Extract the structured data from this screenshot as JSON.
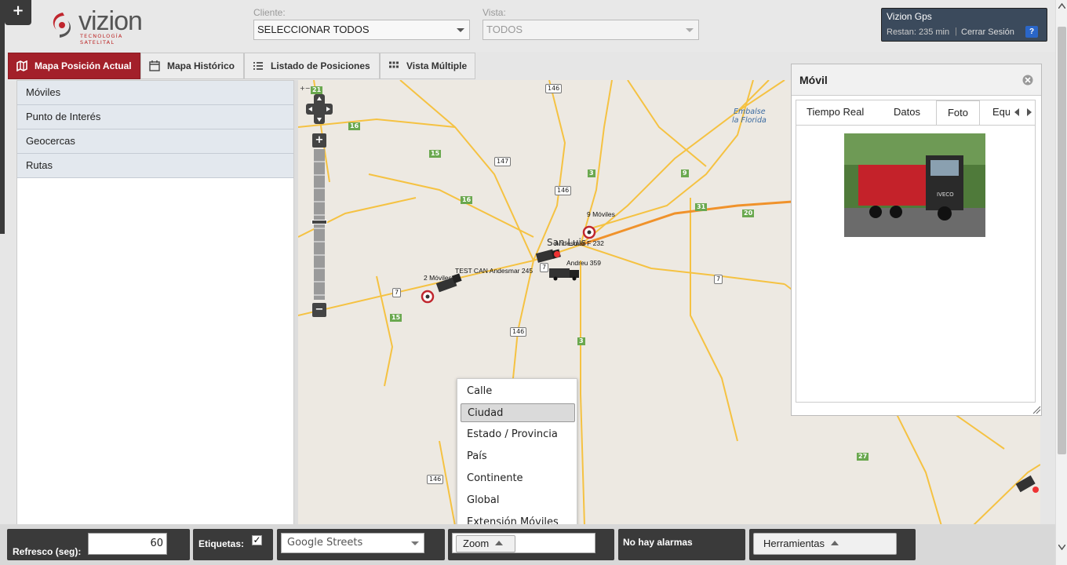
{
  "header": {
    "plus_label": "+",
    "logo_text": "vizion",
    "logo_sub": "TECNOLOGÍA SATELITAL",
    "cliente_label": "Cliente:",
    "cliente_value": "SELECCIONAR TODOS",
    "vista_label": "Vista:",
    "vista_value": "TODOS",
    "user_title": "Vizion Gps",
    "restan": "Restan: 235 min",
    "cerrar": "Cerrar Sesión",
    "help": "?"
  },
  "tabs": [
    {
      "label": "Mapa Posición Actual",
      "icon": "map-icon",
      "active": true
    },
    {
      "label": "Mapa Histórico",
      "icon": "calendar-icon",
      "active": false
    },
    {
      "label": "Listado de Posiciones",
      "icon": "list-icon",
      "active": false
    },
    {
      "label": "Vista Múltiple",
      "icon": "grid-icon",
      "active": false
    }
  ],
  "sidebar": {
    "items": [
      {
        "label": "Móviles"
      },
      {
        "label": "Punto de Interés"
      },
      {
        "label": "Geocercas"
      },
      {
        "label": "Rutas"
      }
    ]
  },
  "map": {
    "road_shields": [
      "146",
      "147",
      "146",
      "146",
      "146",
      "7",
      "7",
      "7"
    ],
    "green_badges": [
      "21",
      "16",
      "15",
      "16",
      "15",
      "3",
      "9",
      "31",
      "20",
      "3",
      "27"
    ],
    "lake_label_1": "Embalse",
    "lake_label_2": "la Florida",
    "city_label": "San Luis",
    "markers": [
      {
        "label": "9 Móviles"
      },
      {
        "label": "Andesmar F 232"
      },
      {
        "label": "Andreu 359"
      },
      {
        "label": "2 Móviles"
      },
      {
        "label": "TEST CAN Andesmar 245"
      }
    ],
    "zoom_plus": "+",
    "zoom_minus": "−",
    "scale_label": "+−"
  },
  "zoom_menu": {
    "options": [
      "Calle",
      "Ciudad",
      "Estado / Provincia",
      "País",
      "Continente",
      "Global",
      "Extensión Móviles"
    ],
    "selected": "Ciudad"
  },
  "movil_panel": {
    "title": "Móvil",
    "tabs": [
      "Tiempo Real",
      "Datos",
      "Foto",
      "Equ"
    ],
    "active_tab": "Foto",
    "truck_brand": "IVECO"
  },
  "bottom": {
    "refresco_label": "Refresco (seg):",
    "refresco_value": "60",
    "etiquetas_label": "Etiquetas:",
    "etiquetas_checked": true,
    "map_type": "Google Streets",
    "zoom_label": "Zoom",
    "alarms": "No hay alarmas",
    "tools_label": "Herramientas"
  },
  "colors": {
    "accent": "#a3202a",
    "dark": "#3a3a3a",
    "road_yellow": "#f5c242",
    "road_orange": "#f0922b",
    "badge_green": "#6aa84f"
  }
}
